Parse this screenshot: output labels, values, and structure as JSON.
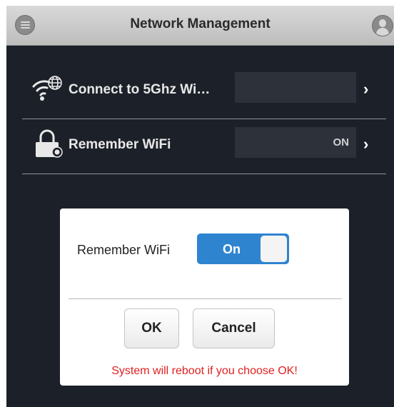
{
  "header": {
    "title": "Network Management",
    "menu_icon": "hamburger-menu-icon",
    "user_icon": "user-avatar-icon"
  },
  "settings": {
    "rows": [
      {
        "icon": "wifi-globe-icon",
        "label": "Connect to 5Ghz Wi…",
        "value": ""
      },
      {
        "icon": "lock-wifi-icon",
        "label": "Remember WiFi",
        "value": "ON"
      }
    ],
    "chevron": "›"
  },
  "dialog": {
    "label": "Remember WiFi",
    "toggle_label": "On",
    "toggle_on": true,
    "ok_label": "OK",
    "cancel_label": "Cancel",
    "warning": "System will reboot if you choose OK!"
  },
  "colors": {
    "background": "#1c2129",
    "header": "#cfcfcf",
    "accent": "#2f84d0",
    "warning": "#e02020"
  }
}
